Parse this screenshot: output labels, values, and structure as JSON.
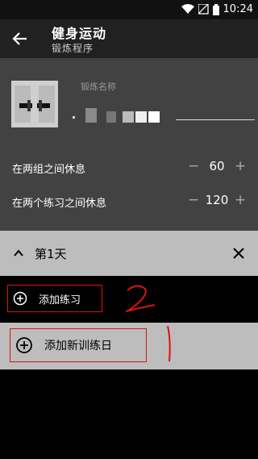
{
  "status_bar": {
    "time": "10:24"
  },
  "app_bar": {
    "title": "健身运动",
    "subtitle": "锻炼程序"
  },
  "settings": {
    "name_label": "锻炼名称",
    "rest_between_sets": {
      "label": "在两组之间休息",
      "value": "60"
    },
    "rest_between_exercises": {
      "label": "在两个练习之间休息",
      "value": "120"
    }
  },
  "day": {
    "title": "第1天"
  },
  "actions": {
    "add_exercise": "添加练习",
    "add_training_day": "添加新训练日"
  },
  "stepper_symbols": {
    "minus": "−",
    "plus": "+"
  },
  "annotations": {
    "mark_2": "2",
    "mark_1": "1"
  },
  "colors": {
    "accent_red": "#dd1111",
    "panel": "#424242",
    "day_bar": "#bdbdbd"
  }
}
